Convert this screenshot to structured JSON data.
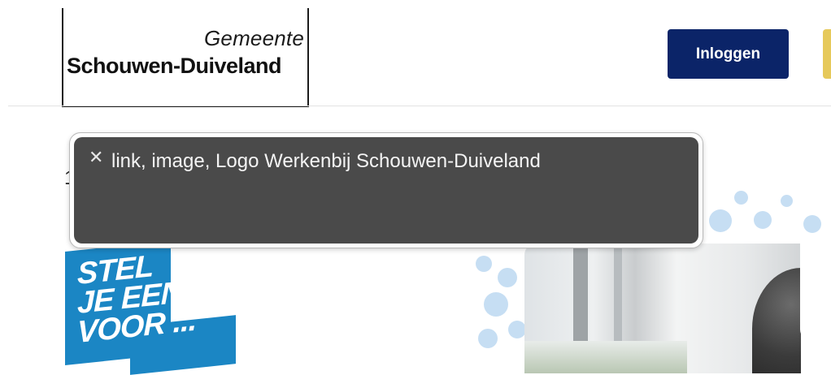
{
  "header": {
    "logo": {
      "line1": "Gemeente",
      "line2": "Schouwen-Duiveland"
    },
    "login_button": "Inloggen"
  },
  "hero": {
    "slogan_lines": [
      "STEL",
      "JE EENS",
      "VOOR ..."
    ],
    "partial_text": "1"
  },
  "accessibility_tooltip": {
    "close_icon": "close-icon",
    "text": "link, image, Logo Werkenbij Schouwen-Duiveland"
  },
  "colors": {
    "login_button_bg": "#0b2468",
    "accent_yellow": "#e6c95a",
    "slogan_blue": "#1b86c4",
    "tooltip_bg": "#4a4a4a"
  }
}
